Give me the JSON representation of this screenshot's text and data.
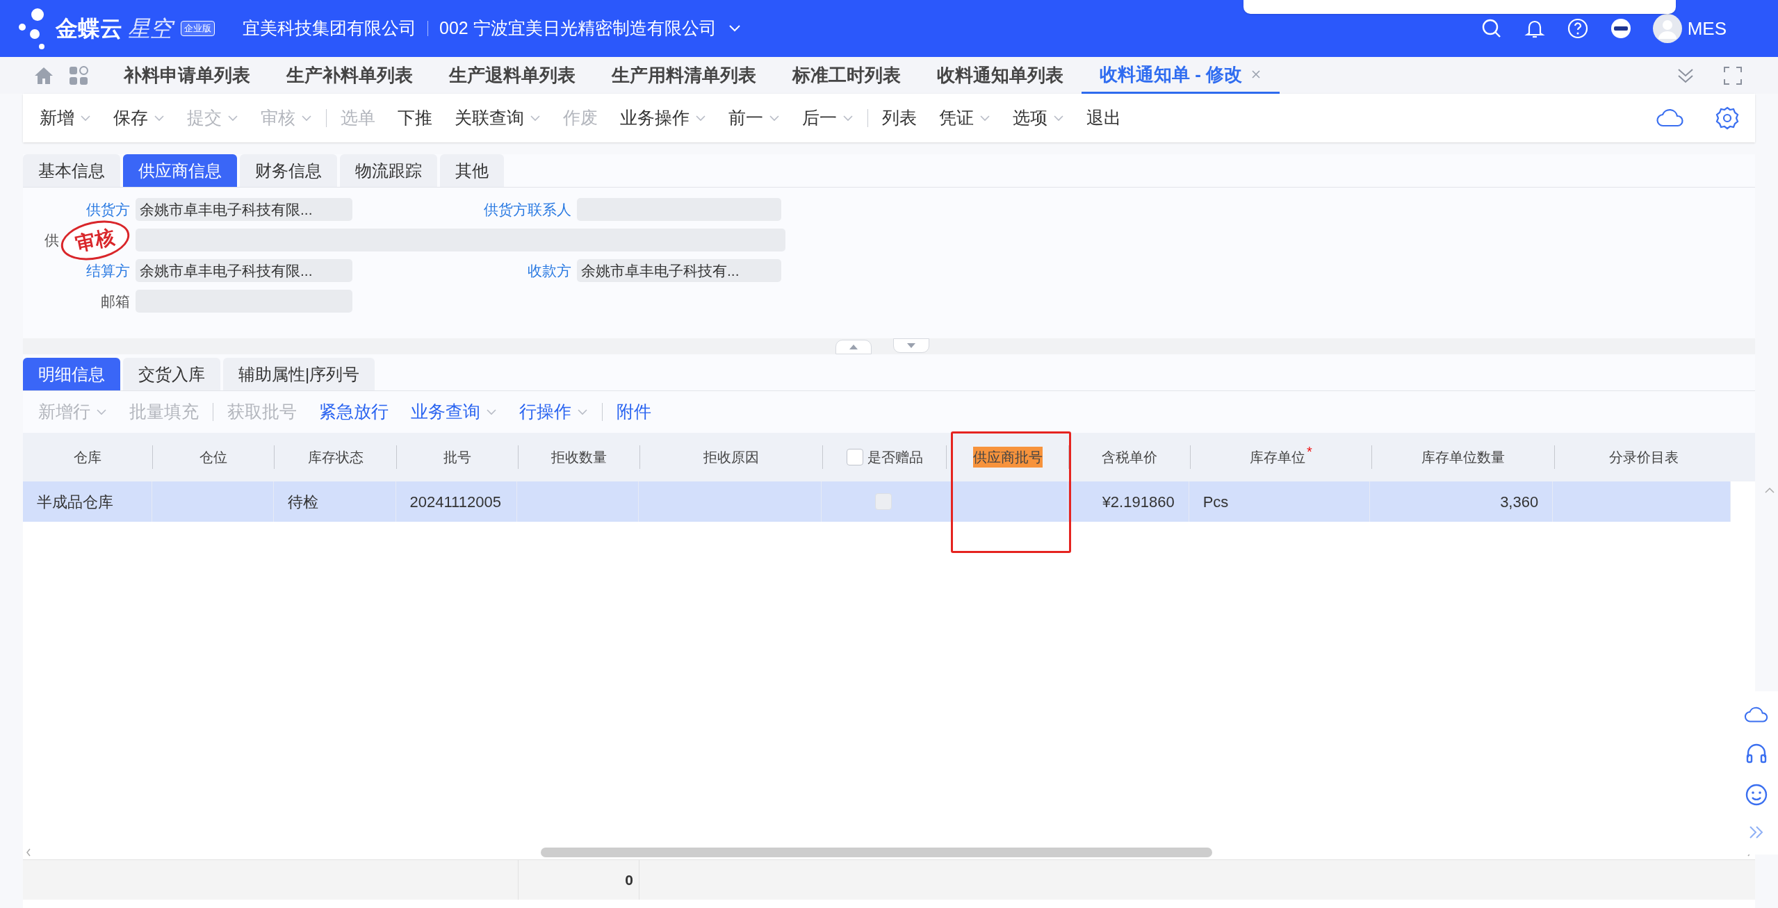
{
  "header": {
    "logo": {
      "brand": "金蝶云",
      "product": "星空",
      "edition": "企业版"
    },
    "company": "宜美科技集团有限公司",
    "org": "002 宁波宜美日光精密制造有限公司",
    "user": "MES"
  },
  "page_tabs": [
    {
      "label": "补料申请单列表",
      "selected": false
    },
    {
      "label": "生产补料单列表",
      "selected": false
    },
    {
      "label": "生产退料单列表",
      "selected": false
    },
    {
      "label": "生产用料清单列表",
      "selected": false
    },
    {
      "label": "标准工时列表",
      "selected": false
    },
    {
      "label": "收料通知单列表",
      "selected": false
    },
    {
      "label": "收料通知单 - 修改",
      "selected": true
    }
  ],
  "toolbar": [
    {
      "kind": "button",
      "label": "新增",
      "dropdown": true,
      "disabled": false
    },
    {
      "kind": "button",
      "label": "保存",
      "dropdown": true,
      "disabled": false
    },
    {
      "kind": "button",
      "label": "提交",
      "dropdown": true,
      "disabled": true
    },
    {
      "kind": "button",
      "label": "审核",
      "dropdown": true,
      "disabled": true
    },
    {
      "kind": "separator"
    },
    {
      "kind": "button",
      "label": "选单",
      "dropdown": false,
      "disabled": true
    },
    {
      "kind": "button",
      "label": "下推",
      "dropdown": false,
      "disabled": false
    },
    {
      "kind": "button",
      "label": "关联查询",
      "dropdown": true,
      "disabled": false
    },
    {
      "kind": "button",
      "label": "作废",
      "dropdown": false,
      "disabled": true
    },
    {
      "kind": "button",
      "label": "业务操作",
      "dropdown": true,
      "disabled": false
    },
    {
      "kind": "button",
      "label": "前一",
      "dropdown": true,
      "disabled": false
    },
    {
      "kind": "button",
      "label": "后一",
      "dropdown": true,
      "disabled": false
    },
    {
      "kind": "separator"
    },
    {
      "kind": "button",
      "label": "列表",
      "dropdown": false,
      "disabled": false
    },
    {
      "kind": "button",
      "label": "凭证",
      "dropdown": true,
      "disabled": false
    },
    {
      "kind": "button",
      "label": "选项",
      "dropdown": true,
      "disabled": false
    },
    {
      "kind": "button",
      "label": "退出",
      "dropdown": false,
      "disabled": false
    }
  ],
  "form_tabs": [
    {
      "label": "基本信息",
      "selected": false
    },
    {
      "label": "供应商信息",
      "selected": true
    },
    {
      "label": "财务信息",
      "selected": false
    },
    {
      "label": "物流跟踪",
      "selected": false
    },
    {
      "label": "其他",
      "selected": false
    }
  ],
  "form_rows": [
    {
      "fields": [
        {
          "label": "供货方",
          "link": true,
          "value": "余姚市卓丰电子科技有限..."
        },
        {
          "label": "供货方联系人",
          "link": true
        }
      ]
    },
    {
      "fields": [
        {
          "label": "供",
          "link": false,
          "wide": true,
          "stamp": "审核"
        }
      ]
    },
    {
      "fields": [
        {
          "label": "结算方",
          "link": true,
          "value": "余姚市卓丰电子科技有限..."
        },
        {
          "label": "收款方",
          "link": true,
          "value": "余姚市卓丰电子科技有..."
        }
      ]
    },
    {
      "fields": [
        {
          "label": "邮箱",
          "link": false
        }
      ]
    }
  ],
  "detail_tabs": [
    {
      "label": "明细信息",
      "selected": true
    },
    {
      "label": "交货入库",
      "selected": false
    },
    {
      "label": "辅助属性|序列号",
      "selected": false
    }
  ],
  "detail_toolbar": [
    {
      "kind": "button",
      "label": "新增行",
      "dropdown": true,
      "disabled": true
    },
    {
      "kind": "button",
      "label": "批量填充",
      "dropdown": false,
      "disabled": true
    },
    {
      "kind": "separator"
    },
    {
      "kind": "button",
      "label": "获取批号",
      "dropdown": false,
      "disabled": true
    },
    {
      "kind": "button",
      "label": "紧急放行",
      "dropdown": false,
      "disabled": false
    },
    {
      "kind": "button",
      "label": "业务查询",
      "dropdown": true,
      "disabled": false
    },
    {
      "kind": "button",
      "label": "行操作",
      "dropdown": true,
      "disabled": false
    },
    {
      "kind": "separator"
    },
    {
      "kind": "button",
      "label": "附件",
      "dropdown": false,
      "disabled": false
    }
  ],
  "table": {
    "columns": [
      {
        "label": "仓库",
        "kind": "text"
      },
      {
        "label": "仓位",
        "kind": "text"
      },
      {
        "label": "库存状态",
        "kind": "text"
      },
      {
        "label": "批号",
        "kind": "text"
      },
      {
        "label": "拒收数量",
        "kind": "number",
        "total": "0"
      },
      {
        "label": "拒收原因",
        "kind": "text"
      },
      {
        "label": "是否赠品",
        "kind": "check",
        "checked": false
      },
      {
        "label": "供应商批号",
        "kind": "text",
        "highlighted": true
      },
      {
        "label": "含税单价",
        "kind": "number"
      },
      {
        "label": "库存单位",
        "kind": "text",
        "required_mark": "*"
      },
      {
        "label": "库存单位数量",
        "kind": "number"
      },
      {
        "label": "分录价目表",
        "kind": "text"
      }
    ],
    "rows": [
      {
        "selected": true,
        "cells": [
          "半成品仓库",
          "",
          "待检",
          "20241112005",
          "",
          "",
          {
            "checked": false
          },
          "",
          "¥2.191860",
          "Pcs",
          "3,360",
          ""
        ]
      }
    ]
  }
}
